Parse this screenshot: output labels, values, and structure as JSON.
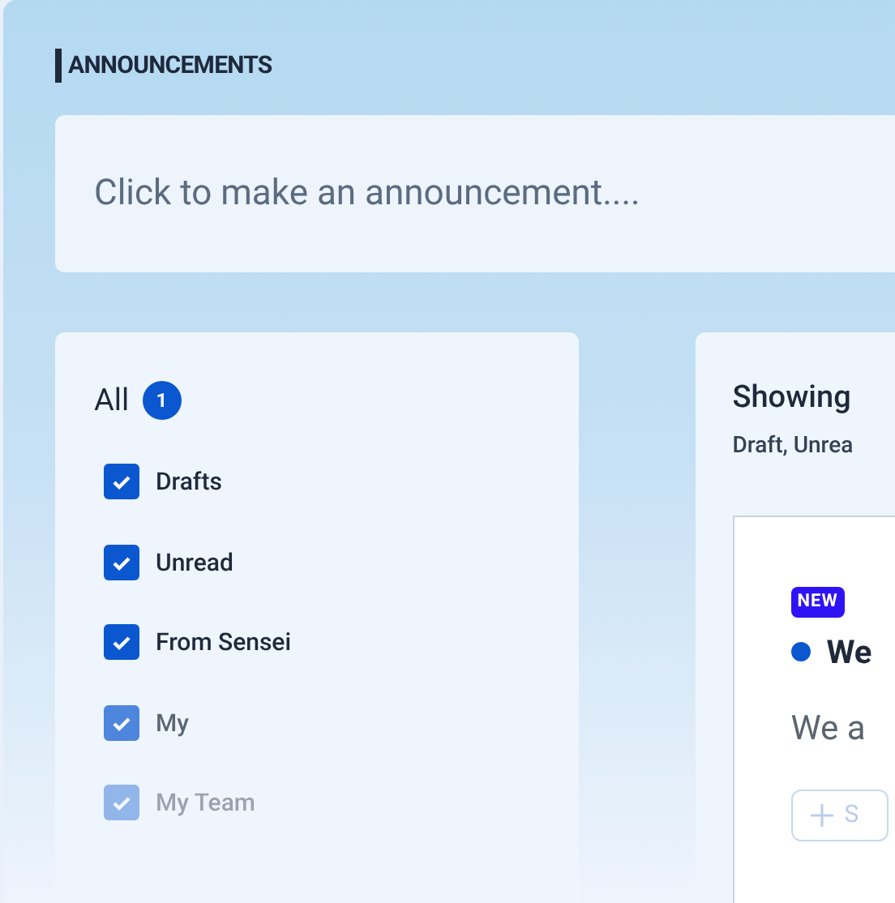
{
  "section_title": "ANNOUNCEMENTS",
  "composer": {
    "placeholder": "Click to make an announcement...."
  },
  "filters": {
    "label": "All",
    "count": "1",
    "items": [
      {
        "label": "Drafts",
        "checked": true
      },
      {
        "label": "Unread",
        "checked": true
      },
      {
        "label": "From Sensei",
        "checked": true
      },
      {
        "label": "My",
        "checked": true
      },
      {
        "label": "My Team",
        "checked": true
      }
    ]
  },
  "results": {
    "heading": "Showing",
    "subheading": "Draft, Unrea",
    "card": {
      "badge": "NEW",
      "unread": true,
      "title": "We",
      "body": "We a",
      "button": "S"
    }
  }
}
